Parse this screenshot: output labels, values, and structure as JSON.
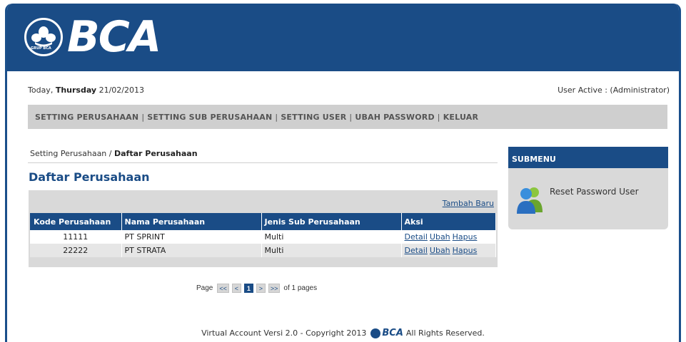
{
  "brand": {
    "logo_text": "BCA",
    "emblem_text": "GRUP BCA"
  },
  "date": {
    "prefix": "Today, ",
    "day": "Thursday",
    "date": "21/02/2013"
  },
  "user_active": "User Active : (Administrator)",
  "menu": {
    "items": [
      "SETTING PERUSAHAAN",
      "SETTING SUB PERUSAHAAN",
      "SETTING USER",
      "UBAH PASSWORD",
      "KELUAR"
    ],
    "separator": "|"
  },
  "breadcrumb": {
    "parent": "Setting Perusahaan",
    "sep": " / ",
    "current": "Daftar Perusahaan"
  },
  "page_title": "Daftar Perusahaan",
  "table": {
    "add_link": "Tambah Baru",
    "headers": [
      "Kode Perusahaan",
      "Nama Perusahaan",
      "Jenis Sub Perusahaan",
      "Aksi"
    ],
    "rows": [
      {
        "code": "11111",
        "name": "PT SPRINT",
        "type": "Multi",
        "actions": [
          "Detail",
          "Ubah",
          "Hapus"
        ]
      },
      {
        "code": "22222",
        "name": "PT STRATA",
        "type": "Multi",
        "actions": [
          "Detail",
          "Ubah",
          "Hapus"
        ]
      }
    ]
  },
  "pager": {
    "label": "Page",
    "first": "<<",
    "prev": "<",
    "current": "1",
    "next": ">",
    "last": ">>",
    "suffix": "of 1 pages"
  },
  "submenu": {
    "title": "SUBMENU",
    "item": "Reset Password User"
  },
  "footer": {
    "prefix": "Virtual Account Versi 2.0 - Copyright 2013",
    "brand": "BCA",
    "suffix": "All Rights Reserved."
  },
  "colors": {
    "primary": "#1a4c86",
    "menubar": "#cfcfcf",
    "panel": "#d9d9d9"
  }
}
